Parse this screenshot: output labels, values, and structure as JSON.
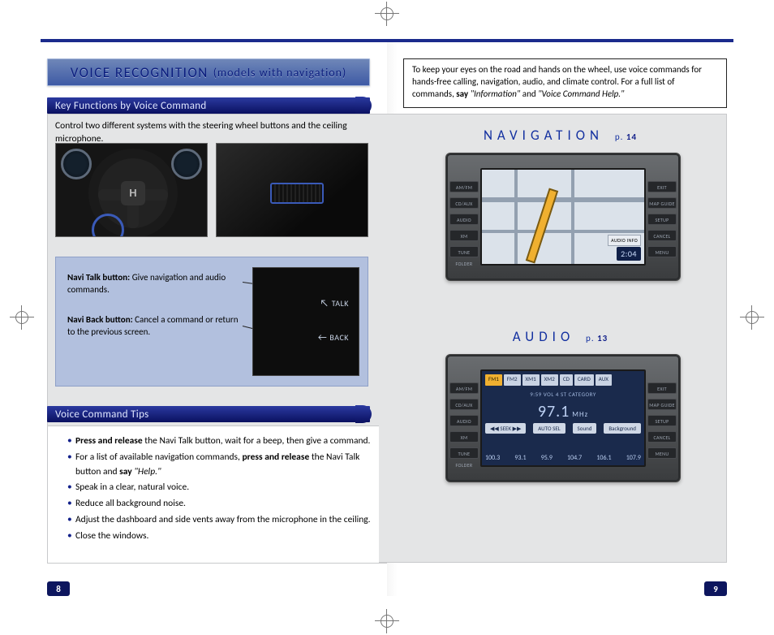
{
  "left": {
    "banner_main": "VOICE RECOGNITION",
    "banner_sub": "(models with navigation)",
    "sub_key": "Key Functions by Voice Command",
    "intro": "Control two different systems with the steering wheel buttons and the ceiling microphone.",
    "navi_talk_label": "Navi Talk button:",
    "navi_talk_text": " Give navigation and audio commands.",
    "navi_back_label": "Navi Back button:",
    "navi_back_text": " Cancel a command or return to the previous screen.",
    "detail_talk": "TALK",
    "detail_back": "BACK",
    "sub_tips": "Voice Command Tips",
    "tips": [
      {
        "b": "Press and release",
        "rest": " the Navi Talk button, wait for a beep, then give a command."
      },
      {
        "plain": "For a list of available navigation commands, ",
        "b": "press and release",
        "rest": " the Navi Talk button and ",
        "b2": "say",
        "i": " \"Help.\""
      },
      {
        "plain": "Speak in a clear, natural voice."
      },
      {
        "plain": "Reduce all background noise."
      },
      {
        "plain": "Adjust the dashboard and side vents away from the microphone in the ceiling."
      },
      {
        "plain": "Close the windows."
      }
    ],
    "page_num": "8"
  },
  "right": {
    "callout_1": "To keep your eyes on the road and hands on the wheel, use voice commands for hands-free calling, navigation, audio, and climate control. For a full list of commands, ",
    "callout_b": "say",
    "callout_i1": " \"Information\"",
    "callout_mid": " and ",
    "callout_i2": "\"Voice Command Help.\"",
    "nav_title": "NAVIGATION",
    "nav_pg_prefix": "p.",
    "nav_pg": "14",
    "audio_title": "AUDIO",
    "audio_pg_prefix": "p.",
    "audio_pg": "13",
    "dev_side_l": [
      "AM/FM",
      "CD/AUX",
      "AUDIO",
      "XM",
      "TUNE FOLDER"
    ],
    "dev_side_r": [
      "EXIT",
      "MAP GUIDE",
      "SETUP",
      "CANCEL",
      "MENU"
    ],
    "nav_clock": "2:04",
    "nav_audio_info": "AUDIO INFO",
    "aud_bands": [
      "FM1",
      "FM2",
      "XM1",
      "XM2",
      "CD",
      "CARD",
      "AUX"
    ],
    "aud_sub": "9:59   VOL 4   ST   CATEGORY",
    "aud_freq": "97.1",
    "aud_mhz": "MHz",
    "aud_btns_seek": "◀◀ SEEK ▶▶",
    "aud_btns": [
      "AUTO SEL",
      "Sound",
      "Background"
    ],
    "aud_presets": [
      "100.3",
      "93.1",
      "95.9",
      "104.7",
      "106.1",
      "107.9"
    ],
    "page_num": "9"
  }
}
